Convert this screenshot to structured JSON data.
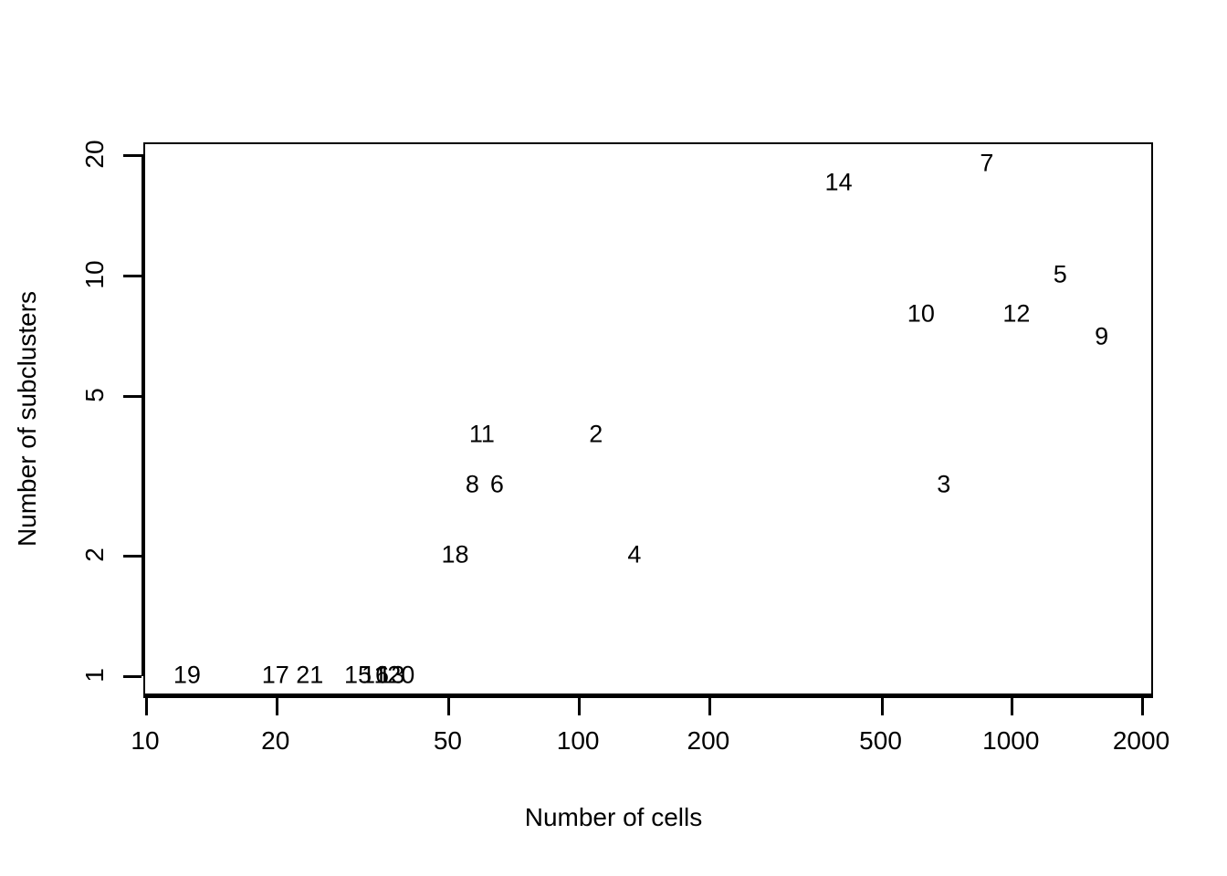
{
  "chart_data": {
    "type": "scatter",
    "title": "",
    "xlabel": "Number of cells",
    "ylabel": "Number of subclusters",
    "xscale": "log",
    "yscale": "log",
    "xlim": [
      10,
      2000
    ],
    "ylim": [
      1,
      20
    ],
    "xticks": [
      10,
      20,
      50,
      100,
      200,
      500,
      1000,
      2000
    ],
    "xtick_labels": [
      "10",
      "20",
      "50",
      "100",
      "200",
      "500",
      "1000",
      "2000"
    ],
    "yticks": [
      1,
      2,
      5,
      10,
      20
    ],
    "ytick_labels": [
      "1",
      "2",
      "5",
      "10",
      "20"
    ],
    "grid": false,
    "legend": null,
    "marker_style": "text-label",
    "points": [
      {
        "label": "1",
        "x": 35,
        "y": 1
      },
      {
        "label": "2",
        "x": 110,
        "y": 4
      },
      {
        "label": "3",
        "x": 700,
        "y": 3
      },
      {
        "label": "4",
        "x": 135,
        "y": 2
      },
      {
        "label": "5",
        "x": 1300,
        "y": 10
      },
      {
        "label": "6",
        "x": 65,
        "y": 3
      },
      {
        "label": "7",
        "x": 880,
        "y": 19
      },
      {
        "label": "8",
        "x": 57,
        "y": 3
      },
      {
        "label": "9",
        "x": 1620,
        "y": 7
      },
      {
        "label": "10",
        "x": 620,
        "y": 8
      },
      {
        "label": "11",
        "x": 60,
        "y": 4
      },
      {
        "label": "12",
        "x": 1030,
        "y": 8
      },
      {
        "label": "13",
        "x": 37,
        "y": 1
      },
      {
        "label": "14",
        "x": 400,
        "y": 17
      },
      {
        "label": "15",
        "x": 31,
        "y": 1
      },
      {
        "label": "16",
        "x": 34,
        "y": 1
      },
      {
        "label": "17",
        "x": 20,
        "y": 1
      },
      {
        "label": "18",
        "x": 52,
        "y": 2
      },
      {
        "label": "19",
        "x": 12.5,
        "y": 1
      },
      {
        "label": "20",
        "x": 39,
        "y": 1
      },
      {
        "label": "21",
        "x": 24,
        "y": 1
      }
    ]
  },
  "axes": {
    "x_title": "Number of cells",
    "y_title": "Number of subclusters"
  }
}
